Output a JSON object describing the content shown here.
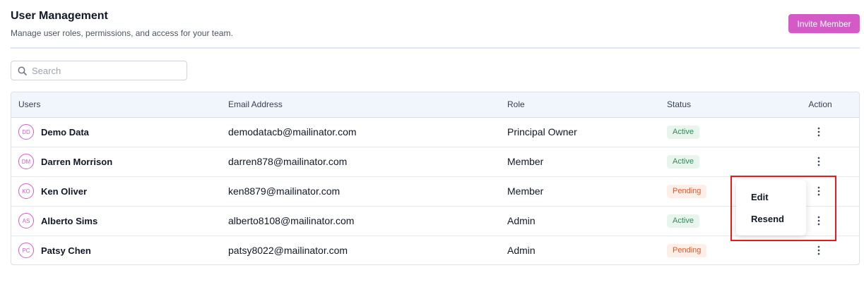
{
  "header": {
    "title": "User Management",
    "subtitle": "Manage user roles, permissions, and access for your team.",
    "invite_label": "Invite Member"
  },
  "search": {
    "placeholder": "Search",
    "value": ""
  },
  "table": {
    "columns": [
      "Users",
      "Email Address",
      "Role",
      "Status",
      "Action"
    ],
    "rows": [
      {
        "initials": "DD",
        "name": "Demo Data",
        "email": "demodatacb@mailinator.com",
        "role": "Principal Owner",
        "status": "Active"
      },
      {
        "initials": "DM",
        "name": "Darren Morrison",
        "email": "darren878@mailinator.com",
        "role": "Member",
        "status": "Active"
      },
      {
        "initials": "KO",
        "name": "Ken Oliver",
        "email": "ken8879@mailinator.com",
        "role": "Member",
        "status": "Pending"
      },
      {
        "initials": "AS",
        "name": "Alberto Sims",
        "email": "alberto8108@mailinator.com",
        "role": "Admin",
        "status": "Active"
      },
      {
        "initials": "PC",
        "name": "Patsy Chen",
        "email": "patsy8022@mailinator.com",
        "role": "Admin",
        "status": "Pending"
      }
    ]
  },
  "action_menu": {
    "items": [
      "Edit",
      "Resend"
    ]
  },
  "colors": {
    "accent": "#d45bc7",
    "active_bg": "#e7f5ec",
    "active_text": "#2f8a55",
    "pending_bg": "#fdeee8",
    "pending_text": "#dd5a2b",
    "highlight": "#e51b1b"
  },
  "icons": {
    "search": "search-icon",
    "row_action": "more-vertical-icon"
  }
}
